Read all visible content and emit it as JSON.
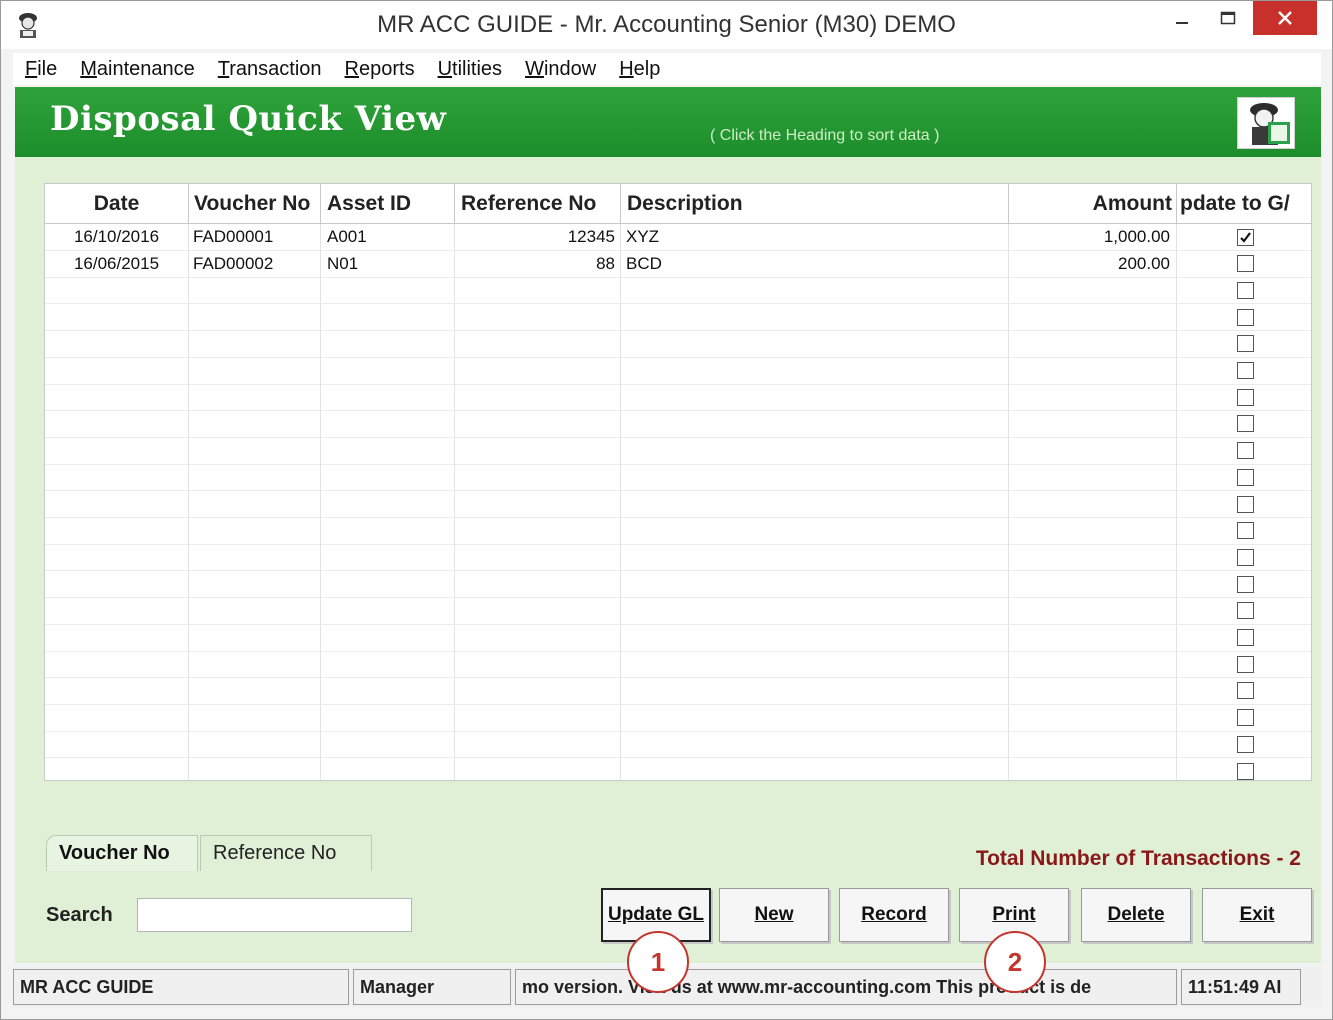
{
  "window": {
    "title": "MR ACC GUIDE - Mr. Accounting Senior (M30) DEMO"
  },
  "menu": [
    {
      "key": "F",
      "rest": "ile"
    },
    {
      "key": "M",
      "rest": "aintenance"
    },
    {
      "key": "T",
      "rest": "ransaction"
    },
    {
      "key": "R",
      "rest": "eports"
    },
    {
      "key": "U",
      "rest": "tilities"
    },
    {
      "key": "W",
      "rest": "indow"
    },
    {
      "key": "H",
      "rest": "elp"
    }
  ],
  "form": {
    "title": "Disposal Quick View",
    "sort_hint": "( Click the Heading to sort data )"
  },
  "grid": {
    "columns": [
      "Date",
      "Voucher No",
      "Asset ID",
      "Reference No",
      "Description",
      "Amount",
      "pdate to G/"
    ],
    "rows": [
      {
        "date": "16/10/2016",
        "voucher_no": "FAD00001",
        "asset_id": "A001",
        "reference_no": "12345",
        "description": "XYZ",
        "amount": "1,000.00",
        "update_gl": true
      },
      {
        "date": "16/06/2015",
        "voucher_no": "FAD00002",
        "asset_id": "N01",
        "reference_no": "88",
        "description": "BCD",
        "amount": "200.00",
        "update_gl": false
      }
    ],
    "empty_row_count": 19
  },
  "tabs": {
    "voucher": "Voucher No",
    "reference": "Reference No"
  },
  "total_label": "Total Number of Transactions - 2",
  "search": {
    "label": "Search",
    "value": ""
  },
  "buttons": {
    "update": "Update GL",
    "new": "New",
    "record": "Record",
    "print": "Print",
    "delete": "Delete",
    "exit": "Exit"
  },
  "status": {
    "app": "MR ACC GUIDE",
    "user": "Manager",
    "message": "mo version.  Visit us at www.mr-accounting.com This product is de",
    "time": "11:51:49 AI"
  },
  "callouts": [
    "1",
    "2"
  ],
  "colors": {
    "banner": "#1f922d",
    "form_bg": "#dff0d7",
    "close": "#c7302b",
    "total_text": "#8a1818",
    "callout": "#c2362d"
  }
}
